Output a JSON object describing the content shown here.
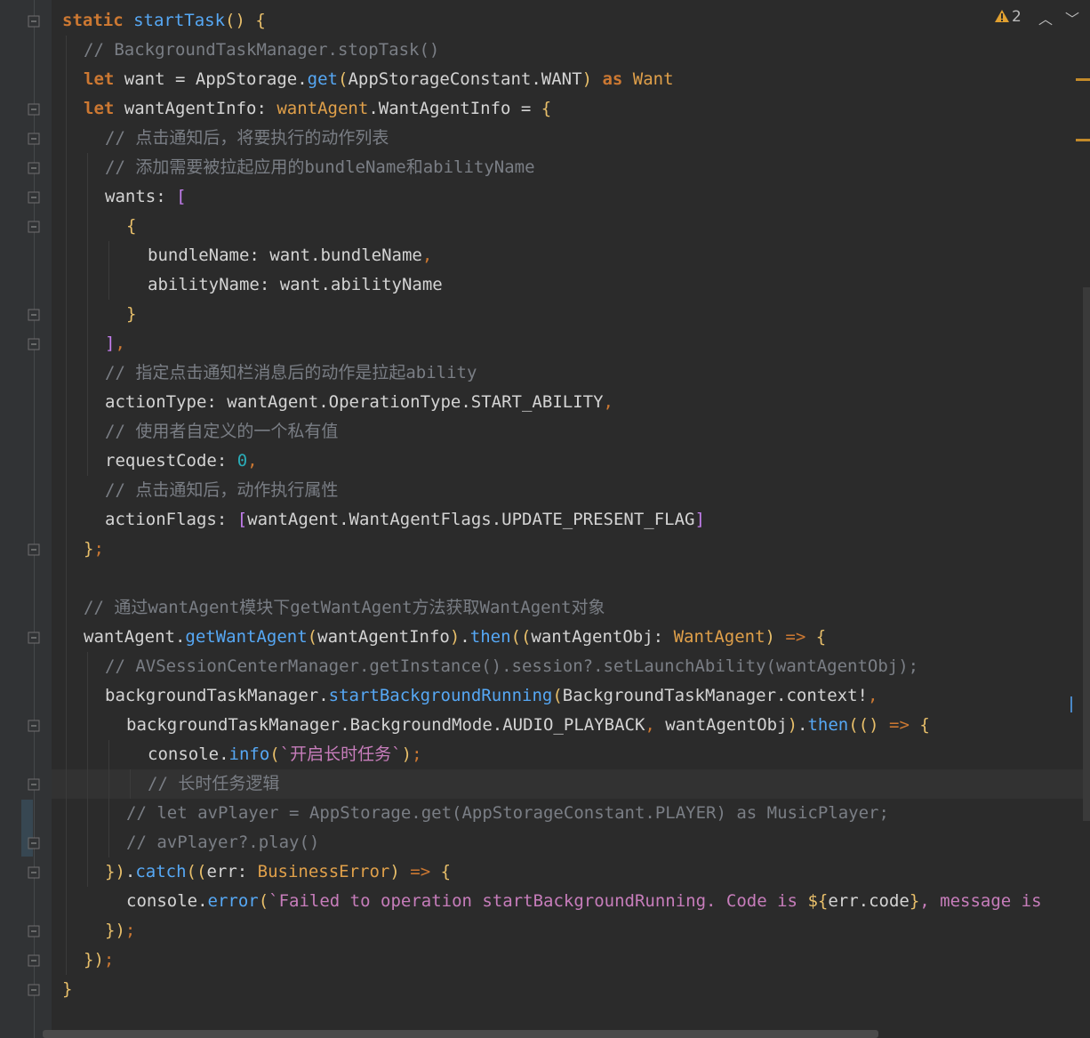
{
  "editor": {
    "warnings": {
      "icon": "warning-icon",
      "count": "2"
    },
    "lines": [
      {
        "indent": 0,
        "tokens": [
          [
            "kw",
            "static "
          ],
          [
            "fn",
            "startTask"
          ],
          [
            "br",
            "() "
          ],
          [
            "br",
            "{"
          ]
        ]
      },
      {
        "indent": 1,
        "tokens": [
          [
            "cmt",
            "// BackgroundTaskManager.stopTask()"
          ]
        ]
      },
      {
        "indent": 1,
        "tokens": [
          [
            "kw",
            "let "
          ],
          [
            "plain",
            "want = AppStorage."
          ],
          [
            "fn",
            "get"
          ],
          [
            "br",
            "("
          ],
          [
            "plain",
            "AppStorageConstant.WANT"
          ],
          [
            "br",
            ") "
          ],
          [
            "kw",
            "as "
          ],
          [
            "type",
            "Want"
          ]
        ]
      },
      {
        "indent": 1,
        "tokens": [
          [
            "kw",
            "let "
          ],
          [
            "plain",
            "wantAgentInfo: "
          ],
          [
            "type",
            "wantAgent"
          ],
          [
            "plain",
            ".WantAgentInfo = "
          ],
          [
            "br",
            "{"
          ]
        ]
      },
      {
        "indent": 2,
        "tokens": [
          [
            "cmt",
            "// 点击通知后，将要执行的动作列表"
          ]
        ]
      },
      {
        "indent": 2,
        "tokens": [
          [
            "cmt",
            "// 添加需要被拉起应用的bundleName和abilityName"
          ]
        ]
      },
      {
        "indent": 2,
        "tokens": [
          [
            "plain",
            "wants: "
          ],
          [
            "br2",
            "["
          ]
        ]
      },
      {
        "indent": 3,
        "tokens": [
          [
            "br",
            "{"
          ]
        ]
      },
      {
        "indent": 4,
        "tokens": [
          [
            "plain",
            "bundleName: want.bundleName"
          ],
          [
            "kw2",
            ","
          ]
        ]
      },
      {
        "indent": 4,
        "tokens": [
          [
            "plain",
            "abilityName: want.abilityName"
          ]
        ]
      },
      {
        "indent": 3,
        "tokens": [
          [
            "br",
            "}"
          ]
        ]
      },
      {
        "indent": 2,
        "tokens": [
          [
            "br2",
            "]"
          ],
          [
            "kw2",
            ","
          ]
        ]
      },
      {
        "indent": 2,
        "tokens": [
          [
            "cmt",
            "// 指定点击通知栏消息后的动作是拉起ability"
          ]
        ]
      },
      {
        "indent": 2,
        "tokens": [
          [
            "plain",
            "actionType: wantAgent.OperationType.START_ABILITY"
          ],
          [
            "kw2",
            ","
          ]
        ]
      },
      {
        "indent": 2,
        "tokens": [
          [
            "cmt",
            "// 使用者自定义的一个私有值"
          ]
        ]
      },
      {
        "indent": 2,
        "tokens": [
          [
            "plain",
            "requestCode: "
          ],
          [
            "num",
            "0"
          ],
          [
            "kw2",
            ","
          ]
        ]
      },
      {
        "indent": 2,
        "tokens": [
          [
            "cmt",
            "// 点击通知后，动作执行属性"
          ]
        ]
      },
      {
        "indent": 2,
        "tokens": [
          [
            "plain",
            "actionFlags: "
          ],
          [
            "br2",
            "["
          ],
          [
            "plain",
            "wantAgent.WantAgentFlags.UPDATE_PRESENT_FLAG"
          ],
          [
            "br2",
            "]"
          ]
        ]
      },
      {
        "indent": 1,
        "tokens": [
          [
            "br",
            "}"
          ],
          [
            "kw2",
            ";"
          ]
        ]
      },
      {
        "indent": 0,
        "tokens": []
      },
      {
        "indent": 1,
        "tokens": [
          [
            "cmt",
            "// 通过wantAgent模块下getWantAgent方法获取WantAgent对象"
          ]
        ]
      },
      {
        "indent": 1,
        "tokens": [
          [
            "plain",
            "wantAgent."
          ],
          [
            "fn",
            "getWantAgent"
          ],
          [
            "br",
            "("
          ],
          [
            "plain",
            "wantAgentInfo"
          ],
          [
            "br",
            ")"
          ],
          [
            "plain",
            "."
          ],
          [
            "fn",
            "then"
          ],
          [
            "br",
            "(("
          ],
          [
            "plain",
            "wantAgentObj: "
          ],
          [
            "type",
            "WantAgent"
          ],
          [
            "br",
            ") "
          ],
          [
            "kw2",
            "=> "
          ],
          [
            "br",
            "{"
          ]
        ]
      },
      {
        "indent": 2,
        "tokens": [
          [
            "cmt",
            "// AVSessionCenterManager.getInstance().session?.setLaunchAbility(wantAgentObj);"
          ]
        ]
      },
      {
        "indent": 2,
        "tokens": [
          [
            "plain",
            "backgroundTaskManager."
          ],
          [
            "fn",
            "startBackgroundRunning"
          ],
          [
            "br",
            "("
          ],
          [
            "plain",
            "BackgroundTaskManager.context!"
          ],
          [
            "kw2",
            ","
          ]
        ]
      },
      {
        "indent": 3,
        "tokens": [
          [
            "plain",
            "backgroundTaskManager.BackgroundMode.AUDIO_PLAYBACK"
          ],
          [
            "kw2",
            ", "
          ],
          [
            "plain",
            "wantAgentObj"
          ],
          [
            "br",
            ")"
          ],
          [
            "plain",
            "."
          ],
          [
            "fn",
            "then"
          ],
          [
            "br",
            "(() "
          ],
          [
            "kw2",
            "=> "
          ],
          [
            "br",
            "{"
          ]
        ]
      },
      {
        "indent": 4,
        "tokens": [
          [
            "plain",
            "console."
          ],
          [
            "fn",
            "info"
          ],
          [
            "br",
            "("
          ],
          [
            "str",
            "`开启长时任务`"
          ],
          [
            "br",
            ")"
          ],
          [
            "kw2",
            ";"
          ]
        ]
      },
      {
        "indent": 4,
        "tokens": [
          [
            "cmt",
            "// 长时任务逻辑"
          ]
        ]
      },
      {
        "indent": 3,
        "tokens": [
          [
            "cmt",
            "// let avPlayer = AppStorage.get(AppStorageConstant.PLAYER) as MusicPlayer;"
          ]
        ]
      },
      {
        "indent": 3,
        "tokens": [
          [
            "cmt",
            "// avPlayer?.play()"
          ]
        ]
      },
      {
        "indent": 2,
        "tokens": [
          [
            "br",
            "})"
          ],
          [
            "plain",
            "."
          ],
          [
            "fn",
            "catch"
          ],
          [
            "br",
            "(("
          ],
          [
            "plain",
            "err: "
          ],
          [
            "type",
            "BusinessError"
          ],
          [
            "br",
            ") "
          ],
          [
            "kw2",
            "=> "
          ],
          [
            "br",
            "{"
          ]
        ]
      },
      {
        "indent": 3,
        "tokens": [
          [
            "plain",
            "console."
          ],
          [
            "fn",
            "error"
          ],
          [
            "br",
            "("
          ],
          [
            "str",
            "`Failed to operation startBackgroundRunning. Code is "
          ],
          [
            "br",
            "${"
          ],
          [
            "plain",
            "err.code"
          ],
          [
            "br",
            "}"
          ],
          [
            "str",
            ", message is"
          ]
        ]
      },
      {
        "indent": 2,
        "tokens": [
          [
            "br",
            "})"
          ],
          [
            "kw2",
            ";"
          ]
        ]
      },
      {
        "indent": 1,
        "tokens": [
          [
            "br",
            "})"
          ],
          [
            "kw2",
            ";"
          ]
        ]
      },
      {
        "indent": 0,
        "tokens": [
          [
            "br",
            "}"
          ]
        ]
      }
    ]
  },
  "colors": {
    "background": "#2b2b2b",
    "gutter": "#313335",
    "keyword": "#cc7832",
    "function": "#56a8f5",
    "comment": "#7a7e85",
    "string": "#c77dbb",
    "number": "#2aacb8"
  }
}
